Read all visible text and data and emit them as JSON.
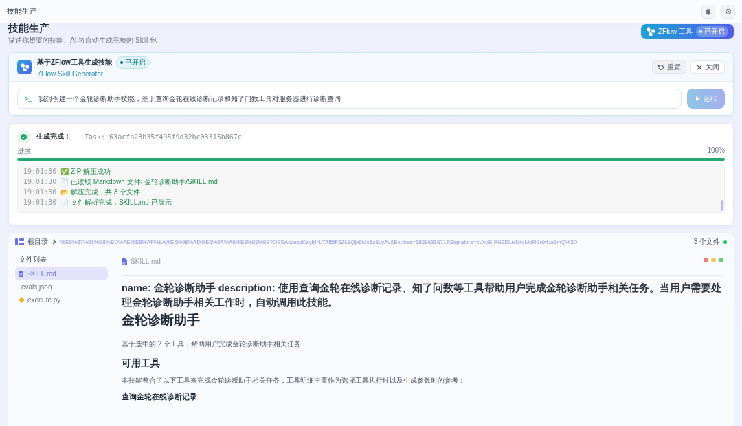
{
  "topbar": {
    "title": "技能生产"
  },
  "header": {
    "title": "技能生产",
    "subtitle": "描述你想要的技能、AI 将自动生成完整的 Skill 包",
    "tool_button": {
      "label": "ZFlow 工具",
      "badge": "已开启",
      "on": true
    }
  },
  "generator": {
    "title": "基于ZFlow工具生成技能",
    "badge": "已开启",
    "on": true,
    "subtitle": "ZFlow Skill Generator",
    "buttons": [
      {
        "label": "重置",
        "kind": "reset"
      },
      {
        "label": "关闭",
        "kind": "close"
      }
    ],
    "prompt": {
      "value": "我想创建一个金轮诊断助手技能，基于查询金轮在线诊断记录和知了问数工具对服务器进行诊断查询"
    },
    "run_button": {
      "label": "运行",
      "disabled": true
    }
  },
  "status": {
    "title": "生成完成！",
    "task": "Task: 63acfb23b35f495f9d32bc03315b867c",
    "progress_label": "进度",
    "progress_reading": "100%",
    "level": 1,
    "log": [
      {
        "time": "19:01:30",
        "message": "✅ ZIP 解压成功"
      },
      {
        "time": "19:01:30",
        "message": "📄 已读取 Markdown 文件: 金轮诊断助手/SKILL.md"
      },
      {
        "time": "19:01:30",
        "message": "📂 解压完成，共 3 个文件"
      },
      {
        "time": "19:01:30",
        "message": "📄 文件解析完成，SKILL.md 已展示"
      }
    ]
  },
  "browser": {
    "root": "根目录",
    "path": "%E9%87%91%E8%BD%AE%E8%AF%8A%E6%96%AD%E5%8A%A9%E6%89%8B?OSSAccessKeyId=LTAI5tF5ZL8Qjk6Mx6o3LyAv&Expires=1838631671&Signature=sVyqBIPH2DluxMtoMoRBnXUu1mQ%3D",
    "file_count": "3 个文件",
    "sidebar": {
      "title": "文件列表",
      "items": [
        {
          "label": "SKILL.md",
          "kind": "md",
          "selected": true
        },
        {
          "label": "evals.json",
          "kind": "json",
          "selected": false
        },
        {
          "label": "execute.py",
          "kind": "py",
          "selected": false
        }
      ]
    },
    "viewer": {
      "filename": "SKILL.md",
      "blocks": [
        {
          "kind": "meta",
          "text": "name: 金轮诊断助手 description: 使用查询金轮在线诊断记录、知了问数等工具帮助用户完成金轮诊断助手相关任务。当用户需要处理金轮诊断助手相关工作时，自动调用此技能。"
        },
        {
          "kind": "h1",
          "text": "金轮诊断助手"
        },
        {
          "kind": "p",
          "text": "基于选中的 2 个工具，帮助用户完成金轮诊断助手相关任务"
        },
        {
          "kind": "h2",
          "text": "可用工具"
        },
        {
          "kind": "p",
          "text": "本技能整合了以下工具来完成金轮诊断助手相关任务，工具明细主要作为选择工具执行时以及生成参数时的参考："
        },
        {
          "kind": "h3",
          "text": "查询金轮在线诊断记录"
        }
      ]
    }
  }
}
